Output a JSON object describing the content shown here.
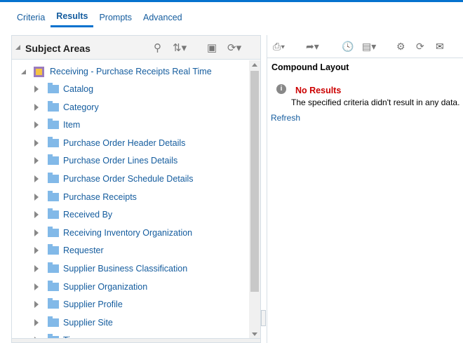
{
  "tabs": [
    {
      "label": "Criteria"
    },
    {
      "label": "Results"
    },
    {
      "label": "Prompts"
    },
    {
      "label": "Advanced"
    }
  ],
  "subject_areas": {
    "title": "Subject Areas",
    "root": "Receiving - Purchase Receipts Real Time",
    "items": [
      "Catalog",
      "Category",
      "Item",
      "Purchase Order Header Details",
      "Purchase Order Lines Details",
      "Purchase Order Schedule Details",
      "Purchase Receipts",
      "Received By",
      "Receiving Inventory Organization",
      "Requester",
      "Supplier Business Classification",
      "Supplier Organization",
      "Supplier Profile",
      "Supplier Site",
      "Time"
    ]
  },
  "results": {
    "layout_title": "Compound Layout",
    "no_results_title": "No Results",
    "no_results_message": "The specified criteria didn't result in any data.",
    "refresh_label": "Refresh"
  },
  "colors": {
    "accent": "#0572ce",
    "link": "#145c9e",
    "error": "#cc0000"
  }
}
